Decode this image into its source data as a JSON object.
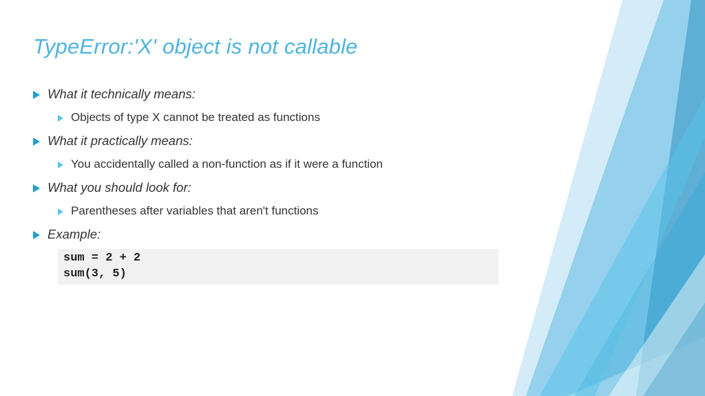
{
  "title": "TypeError:'X' object is not callable",
  "bullets": [
    {
      "heading": "What it technically means:",
      "sub": "Objects of type X cannot be treated as functions"
    },
    {
      "heading": "What it practically means:",
      "sub": "You accidentally called a non-function as if it were a function"
    },
    {
      "heading": "What you should look for:",
      "sub": "Parentheses after variables that aren't functions"
    },
    {
      "heading": "Example:",
      "sub": null
    }
  ],
  "code": "sum = 2 + 2\nsum(3, 5)"
}
